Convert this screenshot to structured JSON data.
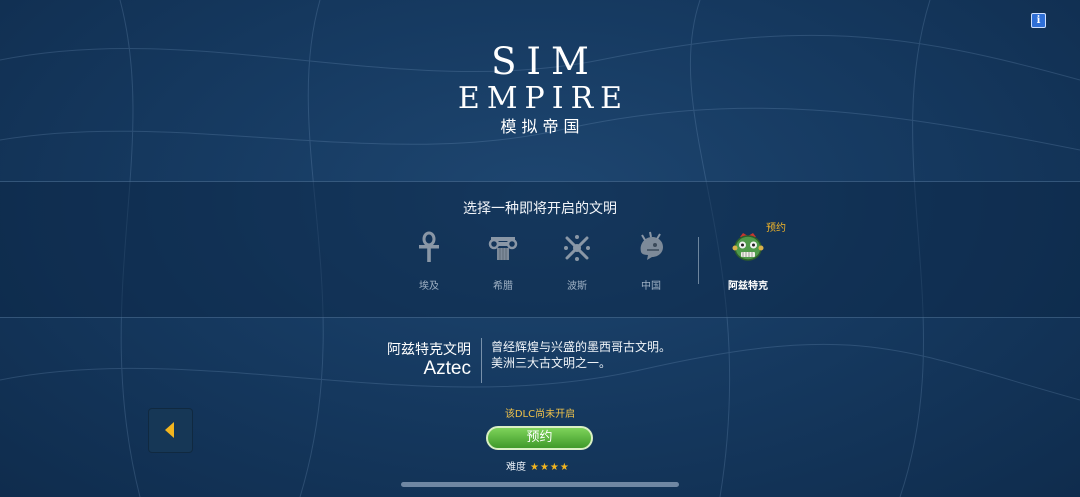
{
  "logo": {
    "line1": "SIM",
    "line2": "EMPIRE",
    "line3": "模拟帝国"
  },
  "info_icon": "info-icon",
  "civ_select": {
    "title": "选择一种即将开启的文明",
    "preorder_tag": "预约",
    "civs": [
      {
        "label": "埃及",
        "icon": "ankh-icon",
        "active": false
      },
      {
        "label": "希腊",
        "icon": "column-capital-icon",
        "active": false
      },
      {
        "label": "波斯",
        "icon": "persian-emblem-icon",
        "active": false
      },
      {
        "label": "中国",
        "icon": "dragon-icon",
        "active": false
      },
      {
        "label": "阿兹特克",
        "icon": "aztec-mask-icon",
        "active": true
      }
    ]
  },
  "detail": {
    "name_cn": "阿兹特克文明",
    "name_en": "Aztec",
    "desc_line1": "曾经辉煌与兴盛的墨西哥古文明。",
    "desc_line2": "美洲三大古文明之一。"
  },
  "actions": {
    "back_icon": "back-arrow-icon",
    "dlc_note": "该DLC尚未开启",
    "preorder_label": "预约",
    "difficulty_label": "难度",
    "difficulty_stars": "★★★★",
    "difficulty_value": 4
  },
  "colors": {
    "accent_gold": "#f3b51f",
    "button_green": "#5bb53f",
    "background": "#163a61"
  }
}
